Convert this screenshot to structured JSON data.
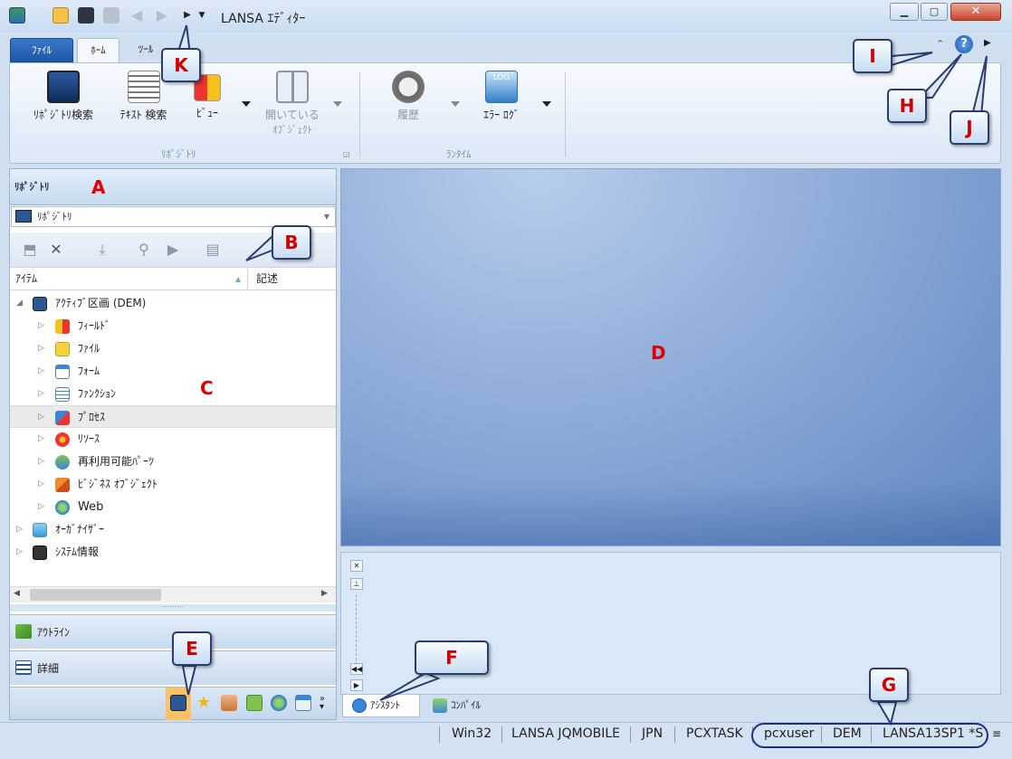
{
  "app": {
    "title": "LANSA ｴﾃﾞｨﾀｰ"
  },
  "tabs": [
    {
      "label": "ﾌｧｲﾙ"
    },
    {
      "label": "ﾎｰﾑ"
    },
    {
      "label": "ﾂｰﾙ"
    }
  ],
  "ribbon": {
    "repo_search": "ﾘﾎﾟｼﾞﾄﾘ検索",
    "text_search": "ﾃｷｽﾄ 検索",
    "view": "ﾋﾞｭｰ",
    "open_objects_line1": "開いている",
    "open_objects_line2": "ｵﾌﾞｼﾞｪｸﾄ",
    "history": "履歴",
    "error_log": "ｴﾗｰ ﾛｸﾞ",
    "log_badge": "LOG",
    "group_repository": "ﾘﾎﾟｼﾞﾄﾘ",
    "group_runtime": "ﾗﾝﾀｲﾑ"
  },
  "left": {
    "header": "ﾘﾎﾟｼﾞﾄﾘ",
    "combo_value": "ﾘﾎﾟｼﾞﾄﾘ",
    "col_item": "ｱｲﾃﾑ",
    "col_desc": "記述",
    "tree": [
      {
        "label": "ｱｸﾃｨﾌﾞ区画 (DEM)"
      },
      {
        "label": "ﾌｨｰﾙﾄﾞ"
      },
      {
        "label": "ﾌｧｲﾙ"
      },
      {
        "label": "ﾌｫｰﾑ"
      },
      {
        "label": "ﾌｧﾝｸｼｮﾝ"
      },
      {
        "label": "ﾌﾟﾛｾｽ"
      },
      {
        "label": "ﾘｿｰｽ"
      },
      {
        "label": "再利用可能ﾊﾟｰﾂ"
      },
      {
        "label": "ﾋﾞｼﾞﾈｽ ｵﾌﾞｼﾞｪｸﾄ"
      },
      {
        "label": "Web"
      },
      {
        "label": "ｵｰｶﾞﾅｲｻﾞｰ"
      },
      {
        "label": "ｼｽﾃﾑ情報"
      }
    ],
    "outline": "ｱｳﾄﾗｲﾝ",
    "details": "詳細"
  },
  "bottom_tabs": {
    "assistant": "ｱｼｽﾀﾝﾄ",
    "compile": "ｺﾝﾊﾟｲﾙ"
  },
  "status": [
    "Win32",
    "LANSA JQMOBILE",
    "JPN",
    "PCXTASK",
    "pcxuser",
    "DEM",
    "LANSA13SP1 *S"
  ],
  "callouts": {
    "A": "A",
    "B": "B",
    "C": "C",
    "D": "D",
    "E": "E",
    "F": "F",
    "G": "G",
    "H": "H",
    "I": "I",
    "J": "J",
    "K": "K"
  }
}
